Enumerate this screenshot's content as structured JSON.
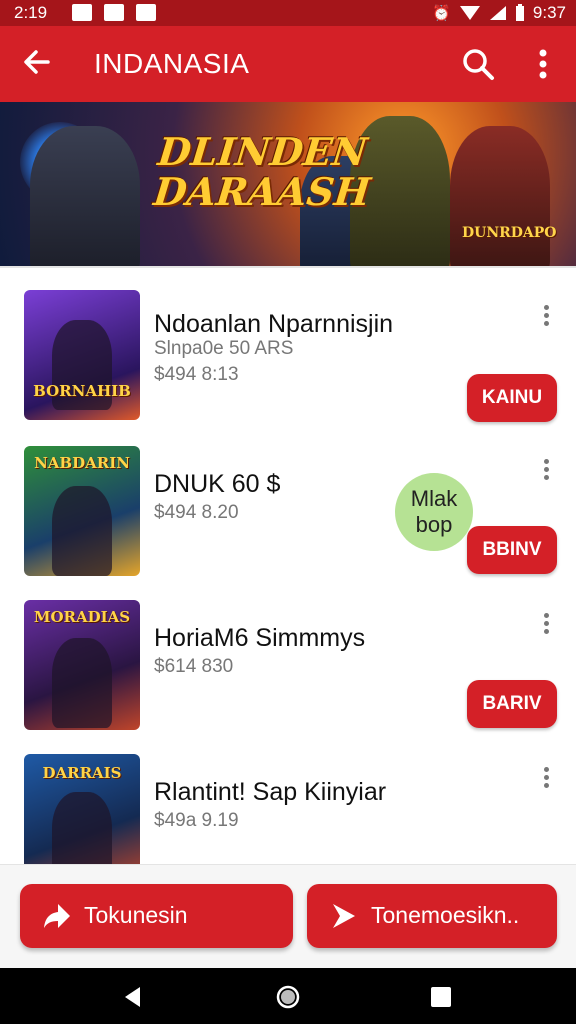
{
  "status_bar": {
    "time_left": "2:19",
    "time_right": "9:37",
    "icons": [
      "image-notification-icon",
      "flipboard-icon",
      "message-icon",
      "alarm-icon",
      "wifi-icon",
      "signal-icon",
      "battery-icon"
    ]
  },
  "app_bar": {
    "title": "INDANASIA",
    "icons": [
      "back-arrow-icon",
      "search-icon",
      "more-vert-icon"
    ]
  },
  "banner": {
    "logo_text": "DLINDEN DARAASH",
    "badge_text": "DUNRDAPO"
  },
  "games": [
    {
      "thumb_title": "BORNAHIB",
      "name": "Ndoanlan Nparnnisjin",
      "line1": "Slnpa0e 50 ARS",
      "line2": "$494 8:13",
      "button": "KAINU"
    },
    {
      "thumb_title": "NABDARIN",
      "name": "DNUK 60 $",
      "line1": "$494 8.20",
      "line2": "",
      "button": "BBINV"
    },
    {
      "thumb_title": "MORADIAS",
      "name": "HoriaM6 Simmmys",
      "line1": "$614 830",
      "line2": "",
      "button": "BARIV"
    },
    {
      "thumb_title": "DARRAIS",
      "name": "Rlantint! Sap Kiinyiar",
      "line1": "$49a 9.19",
      "line2": "",
      "button": ""
    }
  ],
  "bubble": {
    "text": "Mlak bop"
  },
  "bottom_buttons": [
    {
      "label": "Tokunesin",
      "icon": "share-arrow-icon"
    },
    {
      "label": "Tonemoesikn..",
      "icon": "play-arrow-icon"
    }
  ],
  "nav": [
    "back-triangle-icon",
    "home-circle-icon",
    "recents-square-icon"
  ],
  "colors": {
    "primary": "#d42027",
    "status_bar": "#a5151a",
    "bubble": "#b6e294"
  }
}
